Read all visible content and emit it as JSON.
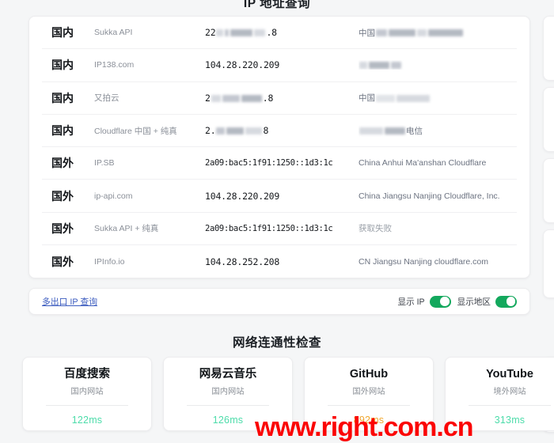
{
  "sections": {
    "ip_lookup_title": "IP 地址查询",
    "connectivity_title": "网络连通性检查"
  },
  "ip_table": {
    "rows": [
      {
        "scope": "国内",
        "source": "Sukka API",
        "ip_visible_prefix": "22",
        "ip_visible_suffix": ".8",
        "ip_redacted": true,
        "location_prefix": "中国",
        "location_redacted": true
      },
      {
        "scope": "国内",
        "source": "IP138.com",
        "ip": "104.28.220.209",
        "ip_redacted": false,
        "location_prefix": "",
        "location_redacted": true
      },
      {
        "scope": "国内",
        "source": "又拍云",
        "ip_visible_prefix": "2",
        "ip_visible_suffix": ".8",
        "ip_redacted": true,
        "location_prefix": "中国",
        "location_redacted": true
      },
      {
        "scope": "国内",
        "source": "Cloudflare 中国 + 纯真",
        "ip_visible_prefix": "2.",
        "ip_visible_suffix": "8",
        "ip_redacted": true,
        "location_prefix": "",
        "location_suffix": "电信",
        "location_redacted": true
      },
      {
        "scope": "国外",
        "source": "IP.SB",
        "ip": "2a09:bac5:1f91:1250::1d3:1c",
        "ip_redacted": false,
        "location": "China Anhui Ma'anshan Cloudflare",
        "location_redacted": false
      },
      {
        "scope": "国外",
        "source": "ip-api.com",
        "ip": "104.28.220.209",
        "ip_redacted": false,
        "location": "China Jiangsu Nanjing Cloudflare, Inc.",
        "location_redacted": false
      },
      {
        "scope": "国外",
        "source": "Sukka API + 纯真",
        "ip": "2a09:bac5:1f91:1250::1d3:1c",
        "ip_redacted": false,
        "location": "获取失败",
        "location_redacted": false,
        "location_dim": true
      },
      {
        "scope": "国外",
        "source": "IPInfo.io",
        "ip": "104.28.252.208",
        "ip_redacted": false,
        "location": "CN Jiangsu Nanjing cloudflare.com",
        "location_redacted": false
      }
    ]
  },
  "ip_footer": {
    "multi_exit_link": "多出口 IP 查询",
    "toggles": [
      {
        "label": "显示 IP",
        "on": true
      },
      {
        "label": "显示地区",
        "on": true
      }
    ]
  },
  "connectivity": {
    "cards": [
      {
        "name": "百度搜索",
        "kind": "国内网站",
        "latency": "122ms",
        "latency_color": "#4ddcaa"
      },
      {
        "name": "网易云音乐",
        "kind": "国内网站",
        "latency": "126ms",
        "latency_color": "#4ddcaa"
      },
      {
        "name": "GitHub",
        "kind": "国外网站",
        "latency": "892ms",
        "latency_color": "#f0a830"
      },
      {
        "name": "YouTube",
        "kind": "境外网站",
        "latency": "313ms",
        "latency_color": "#4ddcaa"
      }
    ]
  },
  "watermark": {
    "text": "www.right.com.cn",
    "color": "#fb0505"
  },
  "theme": {
    "page_background": "#f5f6f7",
    "card_background": "#ffffff",
    "toggle_on_color": "#13a85d",
    "link_color": "#3b5bbf"
  }
}
